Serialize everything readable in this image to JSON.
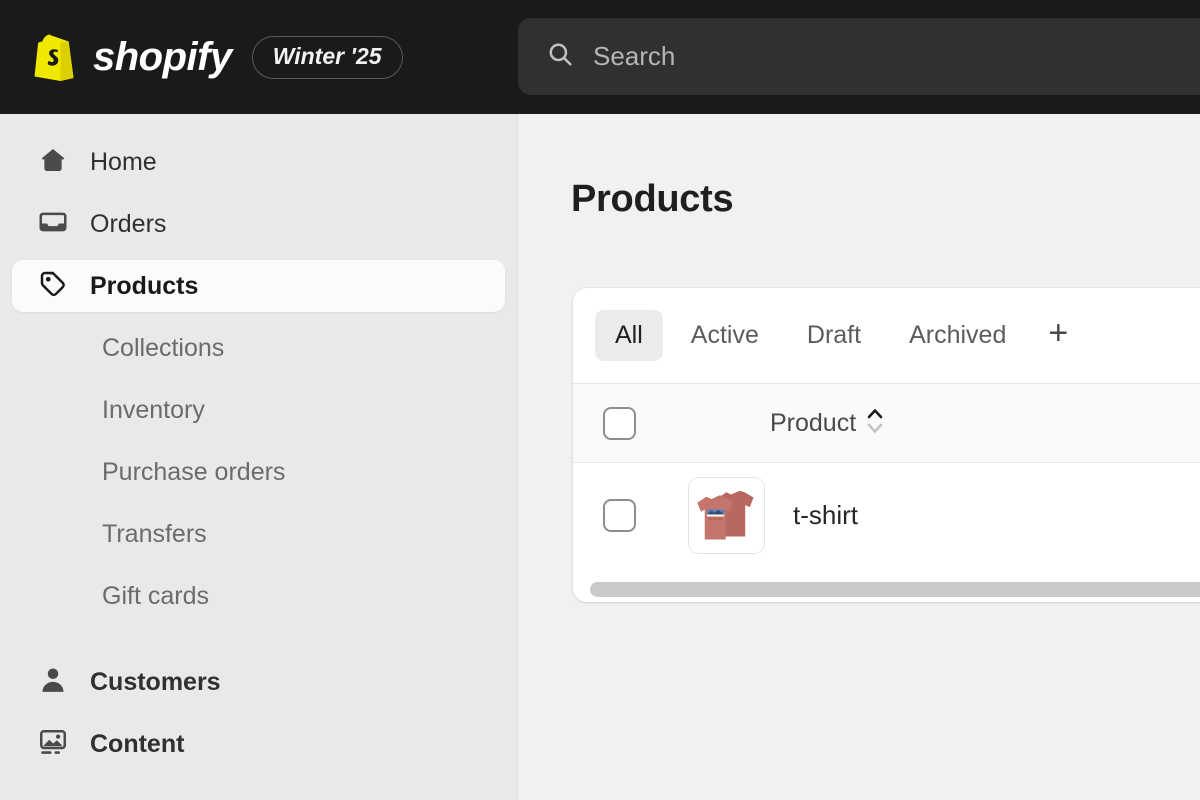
{
  "header": {
    "brand_name": "shopify",
    "brand_logo_icon": "shopify-bag-icon",
    "season_badge": "Winter '25",
    "search": {
      "icon": "search-icon",
      "placeholder": "Search",
      "value": ""
    }
  },
  "sidebar": {
    "items": [
      {
        "label": "Home",
        "icon": "home-icon",
        "type": "nav",
        "active": false
      },
      {
        "label": "Orders",
        "icon": "orders-icon",
        "type": "nav",
        "active": false
      },
      {
        "label": "Products",
        "icon": "products-tag-icon",
        "type": "nav",
        "active": true
      },
      {
        "label": "Collections",
        "icon": "",
        "type": "sub",
        "active": false
      },
      {
        "label": "Inventory",
        "icon": "",
        "type": "sub",
        "active": false
      },
      {
        "label": "Purchase orders",
        "icon": "",
        "type": "sub",
        "active": false
      },
      {
        "label": "Transfers",
        "icon": "",
        "type": "sub",
        "active": false
      },
      {
        "label": "Gift cards",
        "icon": "",
        "type": "sub",
        "active": false
      },
      {
        "label": "Customers",
        "icon": "customers-person-icon",
        "type": "nav",
        "active": false
      },
      {
        "label": "Content",
        "icon": "content-image-icon",
        "type": "nav",
        "active": false
      }
    ]
  },
  "main": {
    "page_title": "Products",
    "tabs": [
      {
        "label": "All",
        "selected": true
      },
      {
        "label": "Active",
        "selected": false
      },
      {
        "label": "Draft",
        "selected": false
      },
      {
        "label": "Archived",
        "selected": false
      }
    ],
    "add_tab_label": "+",
    "table": {
      "select_all_checked": false,
      "columns": [
        {
          "label": "Product",
          "sortable": true,
          "sort_direction": "asc"
        }
      ],
      "rows": [
        {
          "checked": false,
          "thumbnail_alt": "t-shirt-thumbnail",
          "title": "t-shirt"
        }
      ]
    },
    "horizontal_scrollbar": true
  },
  "colors": {
    "topbar_bg": "#1a1a1a",
    "search_bg": "#303030",
    "sidebar_bg": "#e9e9e9",
    "main_bg": "#f1f1f1",
    "card_bg": "#ffffff",
    "brand_yellow": "#f0e800",
    "active_pill": "#fbfbfb",
    "tab_selected_bg": "#ebebeb",
    "text_primary": "#1f1f1f",
    "text_muted": "#6b6b6b",
    "scrollbar": "#c9c9c9",
    "tshirt_fabric": "#c4756c",
    "tshirt_graphic": "#5a7fb8"
  }
}
